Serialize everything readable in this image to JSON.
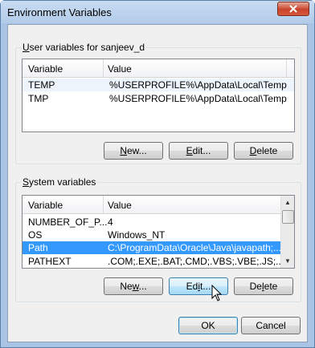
{
  "window": {
    "title": "Environment Variables",
    "close_icon": "close-icon"
  },
  "user_vars": {
    "group_label_prefix": "U",
    "group_label_rest": "ser variables for sanjeev_d",
    "headers": [
      "Variable",
      "Value"
    ],
    "rows": [
      {
        "variable": "TEMP",
        "value": "%USERPROFILE%\\AppData\\Local\\Temp"
      },
      {
        "variable": "TMP",
        "value": "%USERPROFILE%\\AppData\\Local\\Temp"
      }
    ],
    "buttons": {
      "new_u": "N",
      "new_rest": "ew...",
      "edit_u": "E",
      "edit_rest": "dit...",
      "delete_u": "D",
      "delete_rest": "elete"
    }
  },
  "system_vars": {
    "group_label_prefix": "S",
    "group_label_rest": "ystem variables",
    "headers": [
      "Variable",
      "Value"
    ],
    "rows": [
      {
        "variable": "NUMBER_OF_P...",
        "value": "4"
      },
      {
        "variable": "OS",
        "value": "Windows_NT"
      },
      {
        "variable": "Path",
        "value": "C:\\ProgramData\\Oracle\\Java\\javapath;..."
      },
      {
        "variable": "PATHEXT",
        "value": ".COM;.EXE;.BAT;.CMD;.VBS;.VBE;.JS;...."
      }
    ],
    "selected_row": "Path",
    "buttons": {
      "new_u": "w",
      "new_pre": "Ne",
      "new_post": "...",
      "edit_u": "i",
      "edit_pre": "Ed",
      "edit_post": "t...",
      "delete_u": "l",
      "delete_pre": "De",
      "delete_post": "ete"
    }
  },
  "footer": {
    "ok": "OK",
    "cancel": "Cancel"
  },
  "colors": {
    "selection": "#3399ff",
    "title_bar": "#b2cbe9"
  }
}
